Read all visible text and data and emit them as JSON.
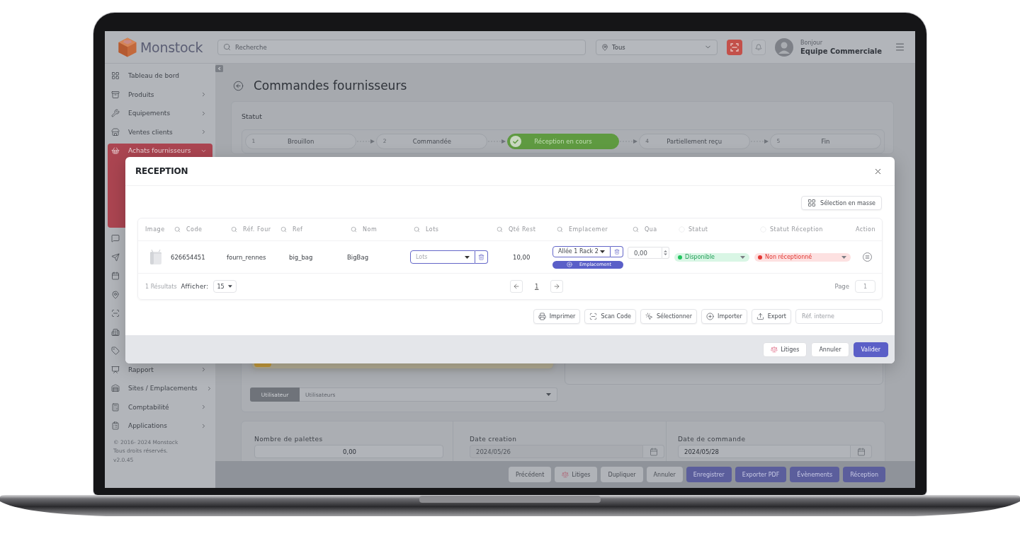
{
  "header": {
    "logo_text": "Monstock",
    "search": {
      "placeholder": "Recherche"
    },
    "location": {
      "value": "Tous"
    },
    "greeting": "Bonjour",
    "user_name": "Equipe Commerciale"
  },
  "sidebar": {
    "items": [
      {
        "kind": "link",
        "label": "Tableau de bord",
        "selected": false
      },
      {
        "kind": "group",
        "label": "Produits",
        "expanded": false,
        "selected": false
      },
      {
        "kind": "group",
        "label": "Equipements",
        "expanded": false,
        "selected": false
      },
      {
        "kind": "group",
        "label": "Ventes clients",
        "expanded": false,
        "selected": false
      },
      {
        "kind": "group",
        "label": "Achats fournisseurs",
        "expanded": true,
        "selected": true
      },
      {
        "kind": "icon_only",
        "selected": false
      },
      {
        "kind": "icon_only",
        "selected": false
      },
      {
        "kind": "icon_only",
        "selected": false
      },
      {
        "kind": "icon_only",
        "selected": false
      },
      {
        "kind": "icon_only",
        "selected": false
      },
      {
        "kind": "icon_only",
        "selected": false
      },
      {
        "kind": "icon_only",
        "selected": false
      },
      {
        "kind": "group",
        "label": "Rapport",
        "expanded": false,
        "selected": false
      },
      {
        "kind": "group",
        "label": "Sites / Emplacements",
        "expanded": false,
        "selected": false
      },
      {
        "kind": "group",
        "label": "Comptabilité",
        "expanded": false,
        "selected": false
      },
      {
        "kind": "group",
        "label": "Applications",
        "expanded": false,
        "selected": false
      }
    ],
    "footer": [
      "© 2016- 2024 Monstock",
      "Tous droits réservés.",
      "v2.0.45"
    ]
  },
  "page": {
    "title": "Commandes fournisseurs",
    "status": {
      "label": "Statut",
      "steps": [
        {
          "number": "1",
          "label": "Brouillon",
          "current": false
        },
        {
          "number": "2",
          "label": "Commandée",
          "current": false
        },
        {
          "label": "Réception en cours",
          "current": true
        },
        {
          "number": "4",
          "label": "Partiellement reçu",
          "current": false
        },
        {
          "number": "5",
          "label": "Fin",
          "current": false
        }
      ]
    }
  },
  "details": {
    "user_tag": "Utilisateur",
    "user_select": {
      "placeholder": "Utilisateurs"
    }
  },
  "summary_fields": [
    {
      "label": "Nombre de palettes",
      "value": "0,00",
      "kind": "number",
      "disabled": false
    },
    {
      "label": "Date creation",
      "value": "2024/05/26",
      "kind": "date",
      "disabled": true
    },
    {
      "label": "Date de commande",
      "value": "2024/05/28",
      "kind": "date",
      "disabled": false
    }
  ],
  "actions": [
    {
      "label": "Précédent",
      "primary": false
    },
    {
      "label": "Litiges",
      "primary": false
    },
    {
      "label": "Dupliquer",
      "primary": false
    },
    {
      "label": "Annuler",
      "primary": false
    },
    {
      "label": "Enregistrer",
      "primary": true
    },
    {
      "label": "Exporter PDF",
      "primary": true
    },
    {
      "label": "Évènements",
      "primary": true
    },
    {
      "label": "Réception",
      "primary": true
    }
  ],
  "modal": {
    "title": "RECEPTION",
    "bulk_button": "Sélection en masse",
    "table": {
      "columns": [
        {
          "label": "Image",
          "kind": "plain"
        },
        {
          "label": "Code",
          "kind": "search"
        },
        {
          "label": "Réf. Four",
          "kind": "search"
        },
        {
          "label": "Ref",
          "kind": "search"
        },
        {
          "label": "Nom",
          "kind": "search"
        },
        {
          "label": "Lots",
          "kind": "search"
        },
        {
          "label": "Qté Rest",
          "kind": "search"
        },
        {
          "label": "Emplacemer",
          "kind": "search"
        },
        {
          "label": "Qua",
          "kind": "search"
        },
        {
          "label": "Statut",
          "kind": "filter"
        },
        {
          "label": "Statut Réception",
          "kind": "filter"
        },
        {
          "label": "Action",
          "kind": "plain"
        }
      ],
      "rows": [
        {
          "code": "626654451",
          "supplier_ref": "fourn_rennes",
          "ref": "big_bag",
          "name": "BigBag",
          "lots": {
            "placeholder": "Lots"
          },
          "qty_remaining": "10,00",
          "location": {
            "value": "Allée 1 Rack 2",
            "add_button": "Emplacement"
          },
          "quantity": "0,00",
          "status": {
            "label": "Disponible",
            "kind": "success"
          },
          "reception_status": {
            "label": "Non réceptionné",
            "kind": "danger"
          }
        }
      ],
      "footer": {
        "results": "1 Résultats",
        "show_label": "Afficher:",
        "page_size": "15",
        "current_page": "1",
        "page_label": "Page",
        "page_input": "1"
      }
    },
    "tools": [
      "Imprimer",
      "Scan Code",
      "Sélectionner",
      "Importer",
      "Export"
    ],
    "ref_field": {
      "placeholder": "Réf. interne"
    },
    "buttons": [
      {
        "label": "Litiges",
        "primary": false
      },
      {
        "label": "Annuler",
        "primary": false
      },
      {
        "label": "Valider",
        "primary": true
      }
    ]
  }
}
